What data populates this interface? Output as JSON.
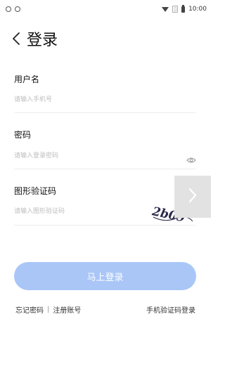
{
  "status_bar": {
    "time": "10:00",
    "icons": [
      "notification-ring-icon",
      "notification-ring-icon",
      "wifi-icon",
      "sim-icon",
      "battery-icon"
    ]
  },
  "header": {
    "title": "登录",
    "back_icon": "chevron-left-icon"
  },
  "form": {
    "username": {
      "label": "用户名",
      "placeholder": "请输入手机号"
    },
    "password": {
      "label": "密码",
      "placeholder": "请输入登录密码",
      "toggle_icon": "eye-icon"
    },
    "captcha": {
      "label": "图形验证码",
      "placeholder": "请输入图形验证码",
      "image_text": "2b09"
    }
  },
  "side_button_icon": "chevron-right-icon",
  "login_button": {
    "label": "马上登录",
    "color": "#a9c6f7"
  },
  "links": {
    "forgot_password": "忘记密码",
    "separator": "|",
    "register": "注册账号",
    "sms_login": "手机验证码登录"
  }
}
